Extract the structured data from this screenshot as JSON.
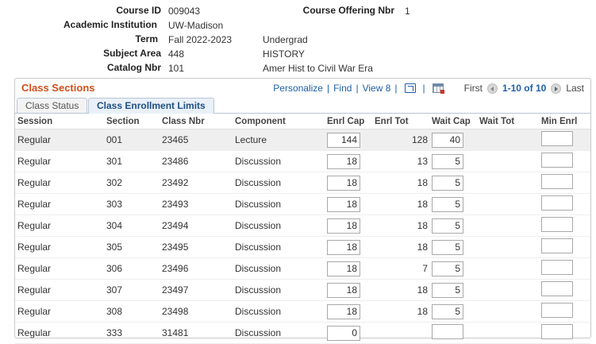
{
  "header": {
    "course_id_label": "Course ID",
    "course_id": "009043",
    "course_offering_label": "Course Offering Nbr",
    "course_offering": "1",
    "institution_label": "Academic Institution",
    "institution": "UW-Madison",
    "term_label": "Term",
    "term": "Fall 2022-2023",
    "career": "Undergrad",
    "subject_label": "Subject Area",
    "subject_code": "448",
    "subject_name": "HISTORY",
    "catalog_label": "Catalog Nbr",
    "catalog_nbr": "101",
    "course_title": "Amer Hist to Civil War Era"
  },
  "grid": {
    "title": "Class Sections",
    "personalize": "Personalize",
    "find": "Find",
    "view": "View 8",
    "first": "First",
    "range": "1-10 of 10",
    "last": "Last"
  },
  "tabs": {
    "class_status": "Class Status",
    "enrollment_limits": "Class Enrollment Limits"
  },
  "columns": {
    "session": "Session",
    "section": "Section",
    "class_nbr": "Class Nbr",
    "component": "Component",
    "enrl_cap": "Enrl Cap",
    "enrl_tot": "Enrl Tot",
    "wait_cap": "Wait Cap",
    "wait_tot": "Wait Tot",
    "min_enrl": "Min Enrl"
  },
  "rows": [
    {
      "session": "Regular",
      "section": "001",
      "class_nbr": "23465",
      "component": "Lecture",
      "enrl_cap": "144",
      "enrl_tot": "128",
      "wait_cap": "40",
      "wait_tot": "",
      "min_enrl": ""
    },
    {
      "session": "Regular",
      "section": "301",
      "class_nbr": "23486",
      "component": "Discussion",
      "enrl_cap": "18",
      "enrl_tot": "13",
      "wait_cap": "5",
      "wait_tot": "",
      "min_enrl": ""
    },
    {
      "session": "Regular",
      "section": "302",
      "class_nbr": "23492",
      "component": "Discussion",
      "enrl_cap": "18",
      "enrl_tot": "18",
      "wait_cap": "5",
      "wait_tot": "",
      "min_enrl": ""
    },
    {
      "session": "Regular",
      "section": "303",
      "class_nbr": "23493",
      "component": "Discussion",
      "enrl_cap": "18",
      "enrl_tot": "18",
      "wait_cap": "5",
      "wait_tot": "",
      "min_enrl": ""
    },
    {
      "session": "Regular",
      "section": "304",
      "class_nbr": "23494",
      "component": "Discussion",
      "enrl_cap": "18",
      "enrl_tot": "18",
      "wait_cap": "5",
      "wait_tot": "",
      "min_enrl": ""
    },
    {
      "session": "Regular",
      "section": "305",
      "class_nbr": "23495",
      "component": "Discussion",
      "enrl_cap": "18",
      "enrl_tot": "18",
      "wait_cap": "5",
      "wait_tot": "",
      "min_enrl": ""
    },
    {
      "session": "Regular",
      "section": "306",
      "class_nbr": "23496",
      "component": "Discussion",
      "enrl_cap": "18",
      "enrl_tot": "7",
      "wait_cap": "5",
      "wait_tot": "",
      "min_enrl": ""
    },
    {
      "session": "Regular",
      "section": "307",
      "class_nbr": "23497",
      "component": "Discussion",
      "enrl_cap": "18",
      "enrl_tot": "18",
      "wait_cap": "5",
      "wait_tot": "",
      "min_enrl": ""
    },
    {
      "session": "Regular",
      "section": "308",
      "class_nbr": "23498",
      "component": "Discussion",
      "enrl_cap": "18",
      "enrl_tot": "18",
      "wait_cap": "5",
      "wait_tot": "",
      "min_enrl": ""
    },
    {
      "session": "Regular",
      "section": "333",
      "class_nbr": "31481",
      "component": "Discussion",
      "enrl_cap": "0",
      "enrl_tot": "",
      "wait_cap": "",
      "wait_tot": "",
      "min_enrl": ""
    }
  ],
  "icons": {
    "download": "download-icon",
    "spreadsheet": "spreadsheet-icon",
    "prev": "prev-arrow-icon",
    "next": "next-arrow-icon"
  },
  "colors": {
    "title": "#d04f1a",
    "link": "#1f5fa8",
    "highlight_row": "#efefef"
  }
}
